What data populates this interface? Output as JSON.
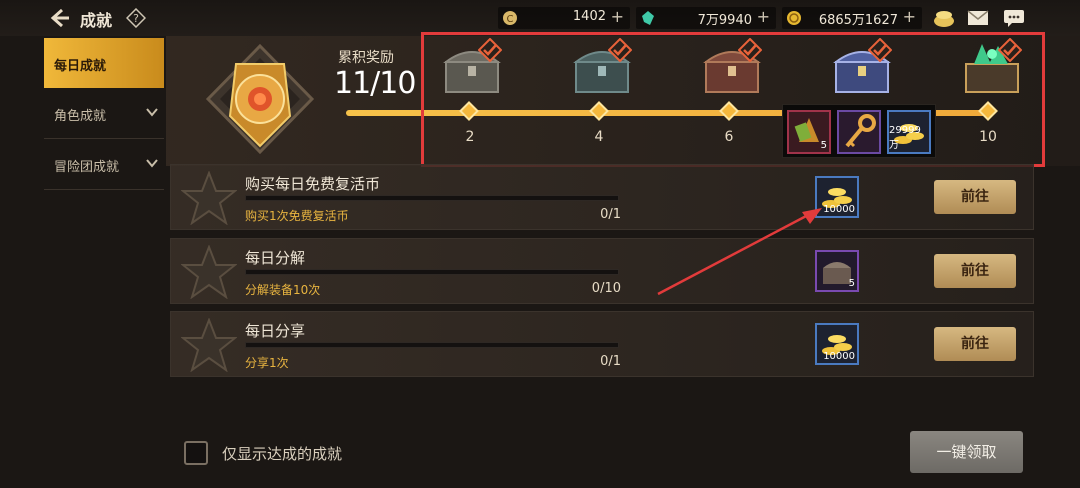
{
  "header": {
    "title": "成就",
    "help_icon": "question-mark-icon",
    "currencies": [
      {
        "icon": "c-coin-icon",
        "value": "1402"
      },
      {
        "icon": "green-crystal-icon",
        "value": "7万9940"
      },
      {
        "icon": "gold-coin-icon",
        "value": "6865万1627"
      }
    ],
    "right_icons": [
      "treasure-pot-icon",
      "mail-icon",
      "chat-icon"
    ]
  },
  "sidebar": {
    "items": [
      {
        "label": "每日成就",
        "active": true
      },
      {
        "label": "角色成就",
        "expandable": true
      },
      {
        "label": "冒险团成就",
        "expandable": true
      }
    ]
  },
  "accumulated": {
    "label": "累积奖励",
    "value": "11/10",
    "progress_fraction": 1.0,
    "milestones": [
      {
        "label": "2",
        "claimed": true
      },
      {
        "label": "4",
        "claimed": true
      },
      {
        "label": "6",
        "claimed": true
      },
      {
        "label": "",
        "claimed": true
      },
      {
        "label": "10",
        "claimed": true
      }
    ],
    "tooltip_items": [
      {
        "icon": "bell-item-icon",
        "count": "5"
      },
      {
        "icon": "golden-key-icon",
        "count": ""
      },
      {
        "icon": "gold-coins-icon",
        "count": "29999万"
      }
    ]
  },
  "achievements": [
    {
      "title": "购买每日免费复活币",
      "desc": "购买1次免费复活币",
      "progress": "0/1",
      "reward_icon": "gold-coins-icon",
      "reward_count": "10000",
      "button": "前往"
    },
    {
      "title": "每日分解",
      "desc": "分解装备10次",
      "progress": "0/10",
      "reward_icon": "chest-icon",
      "reward_count": "5",
      "button": "前往"
    },
    {
      "title": "每日分享",
      "desc": "分享1次",
      "progress": "0/1",
      "reward_icon": "gold-coins-icon",
      "reward_count": "10000",
      "button": "前往"
    }
  ],
  "footer": {
    "checkbox_label": "仅显示达成的成就",
    "claim_all": "一键领取"
  },
  "colors": {
    "accent_gold": "#f0b83a",
    "highlight_red": "#e23b3b"
  }
}
